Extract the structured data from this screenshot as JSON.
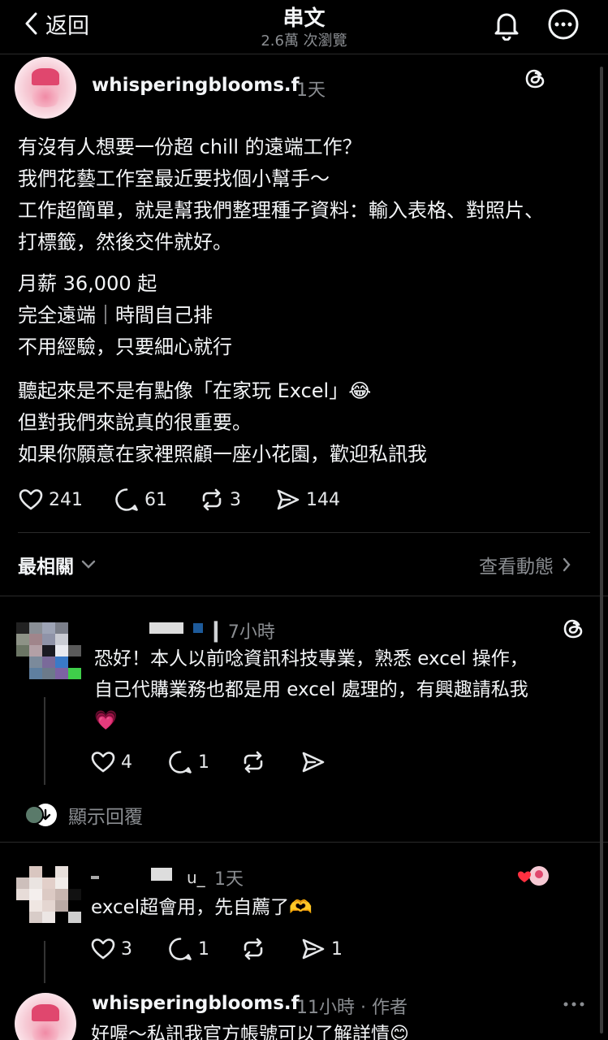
{
  "header": {
    "back_label": "返回",
    "title": "串文",
    "subtitle": "2.6萬 次瀏覽"
  },
  "post": {
    "username": "whisperingblooms.f",
    "time": "1天",
    "paragraphs": [
      [
        "有沒有人想要一份超 chill 的遠端工作？",
        "我們花藝工作室最近要找個小幫手～",
        "工作超簡單，就是幫我們整理種子資料：輸入表格、對照片、",
        "打標籤，然後交件就好。"
      ],
      [
        "月薪 36,000 起",
        "完全遠端｜時間自己排",
        "不用經驗，只要細心就行"
      ],
      [
        "聽起來是不是有點像「在家玩 Excel」😂",
        "但對我們來說真的很重要。",
        "如果你願意在家裡照顧一座小花園，歡迎私訊我"
      ]
    ],
    "stats": {
      "likes": "241",
      "replies": "61",
      "reposts": "3",
      "shares": "144"
    }
  },
  "sort": {
    "label": "最相關",
    "activity_label": "查看動態"
  },
  "comments": [
    {
      "time": "7小時",
      "name_fragment": "▎",
      "lines": [
        "恐好！本人以前唸資訊科技專業，熟悉 excel 操作，",
        "自己代購業務也都是用 excel 處理的，有興趣請私我",
        "💗"
      ],
      "likes": "4",
      "replies": "1",
      "show_replies_label": "顯示回覆"
    },
    {
      "name_fragment": "u_",
      "time": "1天",
      "lines": [
        "excel超會用，先自薦了🫶"
      ],
      "likes": "3",
      "replies": "1",
      "shares": "1"
    }
  ],
  "reply": {
    "username": "whisperingblooms.f",
    "meta": "11小時 · 作者",
    "text": "好喔～私訊我官方帳號可以了解詳情😊"
  },
  "colors": {
    "background": "#000000",
    "text": "#f3f5f7",
    "muted": "#8a8d91",
    "like_red": "#ff3040"
  }
}
